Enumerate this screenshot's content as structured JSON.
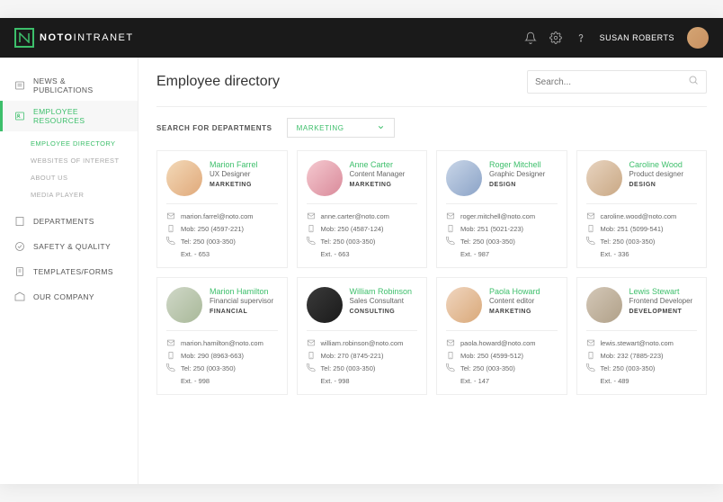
{
  "header": {
    "brand_bold": "NOTO",
    "brand_light": "INTRANET",
    "user_name": "SUSAN ROBERTS"
  },
  "sidebar": {
    "items": [
      {
        "label": "NEWS & PUBLICATIONS",
        "icon": "news"
      },
      {
        "label": "EMPLOYEE RESOURCES",
        "icon": "resources",
        "active": true
      },
      {
        "label": "DEPARTMENTS",
        "icon": "departments"
      },
      {
        "label": "SAFETY & QUALITY",
        "icon": "safety"
      },
      {
        "label": "TEMPLATES/FORMS",
        "icon": "templates"
      },
      {
        "label": "OUR COMPANY",
        "icon": "company"
      }
    ],
    "subitems": [
      {
        "label": "EMPLOYEE DIRECTORY",
        "active": true
      },
      {
        "label": "WEBSITES OF INTEREST"
      },
      {
        "label": "ABOUT US"
      },
      {
        "label": "MEDIA PLAYER"
      }
    ]
  },
  "page": {
    "title": "Employee directory",
    "search_placeholder": "Search...",
    "filter_label": "SEARCH FOR DEPARTMENTS",
    "filter_value": "MARKETING"
  },
  "employees": [
    {
      "name": "Marion Farrel",
      "role": "UX Designer",
      "dept": "MARKETING",
      "email": "marion.farrel@noto.com",
      "mob": "Mob: 250 (4597-221)",
      "tel": "Tel: 250 (003-350)",
      "ext": "Ext. - 653",
      "av": "av1"
    },
    {
      "name": "Anne Carter",
      "role": "Content Manager",
      "dept": "MARKETING",
      "email": "anne.carter@noto.com",
      "mob": "Mob: 250 (4587-124)",
      "tel": "Tel: 250 (003-350)",
      "ext": "Ext. - 663",
      "av": "av2"
    },
    {
      "name": "Roger Mitchell",
      "role": "Graphic Designer",
      "dept": "DESIGN",
      "email": "roger.mitchell@noto.com",
      "mob": "Mob: 251 (5021-223)",
      "tel": "Tel: 250 (003-350)",
      "ext": "Ext. - 987",
      "av": "av3"
    },
    {
      "name": "Caroline Wood",
      "role": "Product designer",
      "dept": "DESIGN",
      "email": "caroline.wood@noto.com",
      "mob": "Mob: 251 (5099-541)",
      "tel": "Tel: 250 (003-350)",
      "ext": "Ext. - 336",
      "av": "av4"
    },
    {
      "name": "Marion Hamilton",
      "role": "Financial supervisor",
      "dept": "FINANCIAL",
      "email": "marion.hamilton@noto.com",
      "mob": "Mob: 290 (8963-663)",
      "tel": "Tel: 250 (003-350)",
      "ext": "Ext. - 998",
      "av": "av5"
    },
    {
      "name": "William Robinson",
      "role": "Sales Consultant",
      "dept": "CONSULTING",
      "email": "william.robinson@noto.com",
      "mob": "Mob: 270 (8745-221)",
      "tel": "Tel: 250 (003-350)",
      "ext": "Ext. - 998",
      "av": "av6"
    },
    {
      "name": "Paola Howard",
      "role": "Content editor",
      "dept": "MARKETING",
      "email": "paola.howard@noto.com",
      "mob": "Mob: 250 (4599-512)",
      "tel": "Tel: 250 (003-350)",
      "ext": "Ext. - 147",
      "av": "av7"
    },
    {
      "name": "Lewis Stewart",
      "role": "Frontend Developer",
      "dept": "DEVELOPMENT",
      "email": "lewis.stewart@noto.com",
      "mob": "Mob: 232 (7885-223)",
      "tel": "Tel: 250 (003-350)",
      "ext": "Ext. - 489",
      "av": "av8"
    }
  ]
}
